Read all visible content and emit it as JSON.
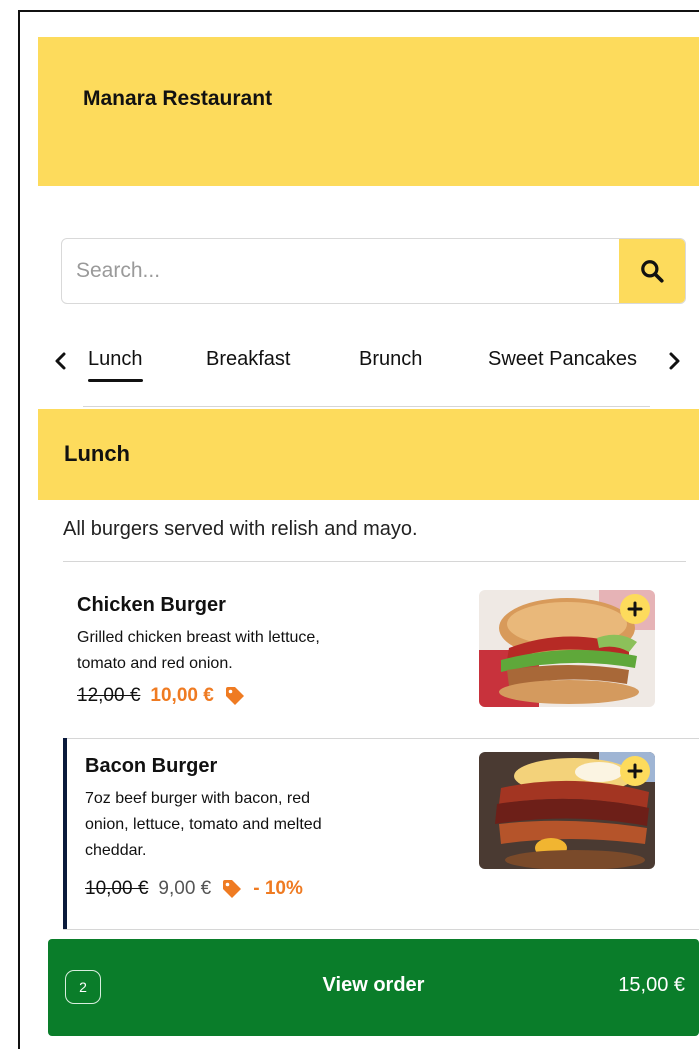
{
  "app": {
    "title": "Manara Restaurant"
  },
  "search": {
    "placeholder": "Search...",
    "value": ""
  },
  "tabs": [
    {
      "label": "Lunch",
      "active": true
    },
    {
      "label": "Breakfast",
      "active": false
    },
    {
      "label": "Brunch",
      "active": false
    },
    {
      "label": "Sweet Pancakes",
      "active": false
    }
  ],
  "section": {
    "title": "Lunch",
    "note": "All burgers served with relish and mayo."
  },
  "items": [
    {
      "name": "Chicken Burger",
      "description": [
        "Grilled chicken breast with lettuce,",
        "tomato and red onion."
      ],
      "old_price": "12,00 €",
      "price": "10,00 €",
      "discount": ""
    },
    {
      "name": "Bacon Burger",
      "description": [
        "7oz beef burger with bacon, red",
        "onion, lettuce, tomato and melted",
        "cheddar."
      ],
      "old_price": "10,00 €",
      "price": "9,00 €",
      "discount": "- 10%"
    }
  ],
  "order": {
    "count": "2",
    "label": "View order",
    "total": "15,00 €"
  },
  "colors": {
    "accent": "#fddb5c",
    "order_bar": "#0a7d2a",
    "discount": "#ef7b22",
    "selected_marker": "#0a1a3b"
  },
  "icons": [
    "search-icon",
    "chevron-left-icon",
    "chevron-right-icon",
    "tag-icon",
    "plus-icon"
  ]
}
